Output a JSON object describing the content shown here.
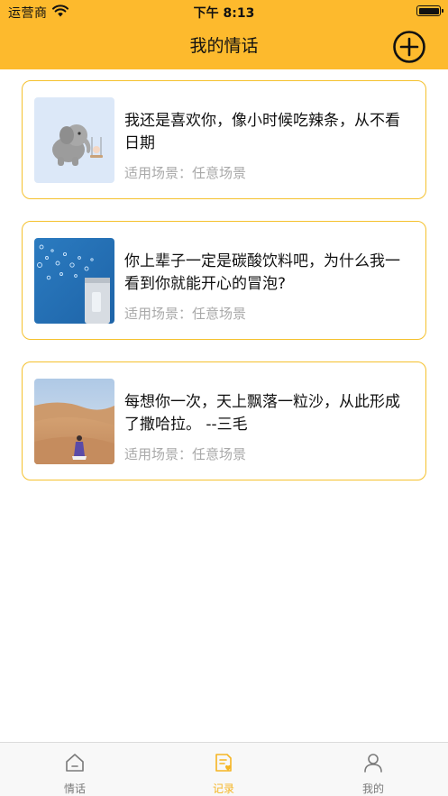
{
  "status_bar": {
    "carrier": "运营商",
    "time": "下午 8:13"
  },
  "nav": {
    "title": "我的情话",
    "add_icon": "plus-circle-icon"
  },
  "cards": [
    {
      "text": "我还是喜欢你，像小时候吃辣条，从不看日期",
      "scene": "适用场景：任意场景",
      "image": "elephant-illustration"
    },
    {
      "text": "你上辈子一定是碳酸饮料吧，为什么我一看到你就能开心的冒泡?",
      "scene": "适用场景：任意场景",
      "image": "bubbles-photo"
    },
    {
      "text": "每想你一次，天上飘落一粒沙，从此形成了撒哈拉。 --三毛",
      "scene": "适用场景：任意场景",
      "image": "desert-photo"
    }
  ],
  "tabs": [
    {
      "label": "情话",
      "icon": "home-icon",
      "active": false
    },
    {
      "label": "记录",
      "icon": "notes-icon",
      "active": true
    },
    {
      "label": "我的",
      "icon": "user-icon",
      "active": false
    }
  ],
  "colors": {
    "header": "#FDBA2D",
    "card_border": "#F5C12E",
    "active_tab": "#F5B523",
    "inactive_tab": "#7A7A7A",
    "scene_text": "#A9A9A9"
  }
}
